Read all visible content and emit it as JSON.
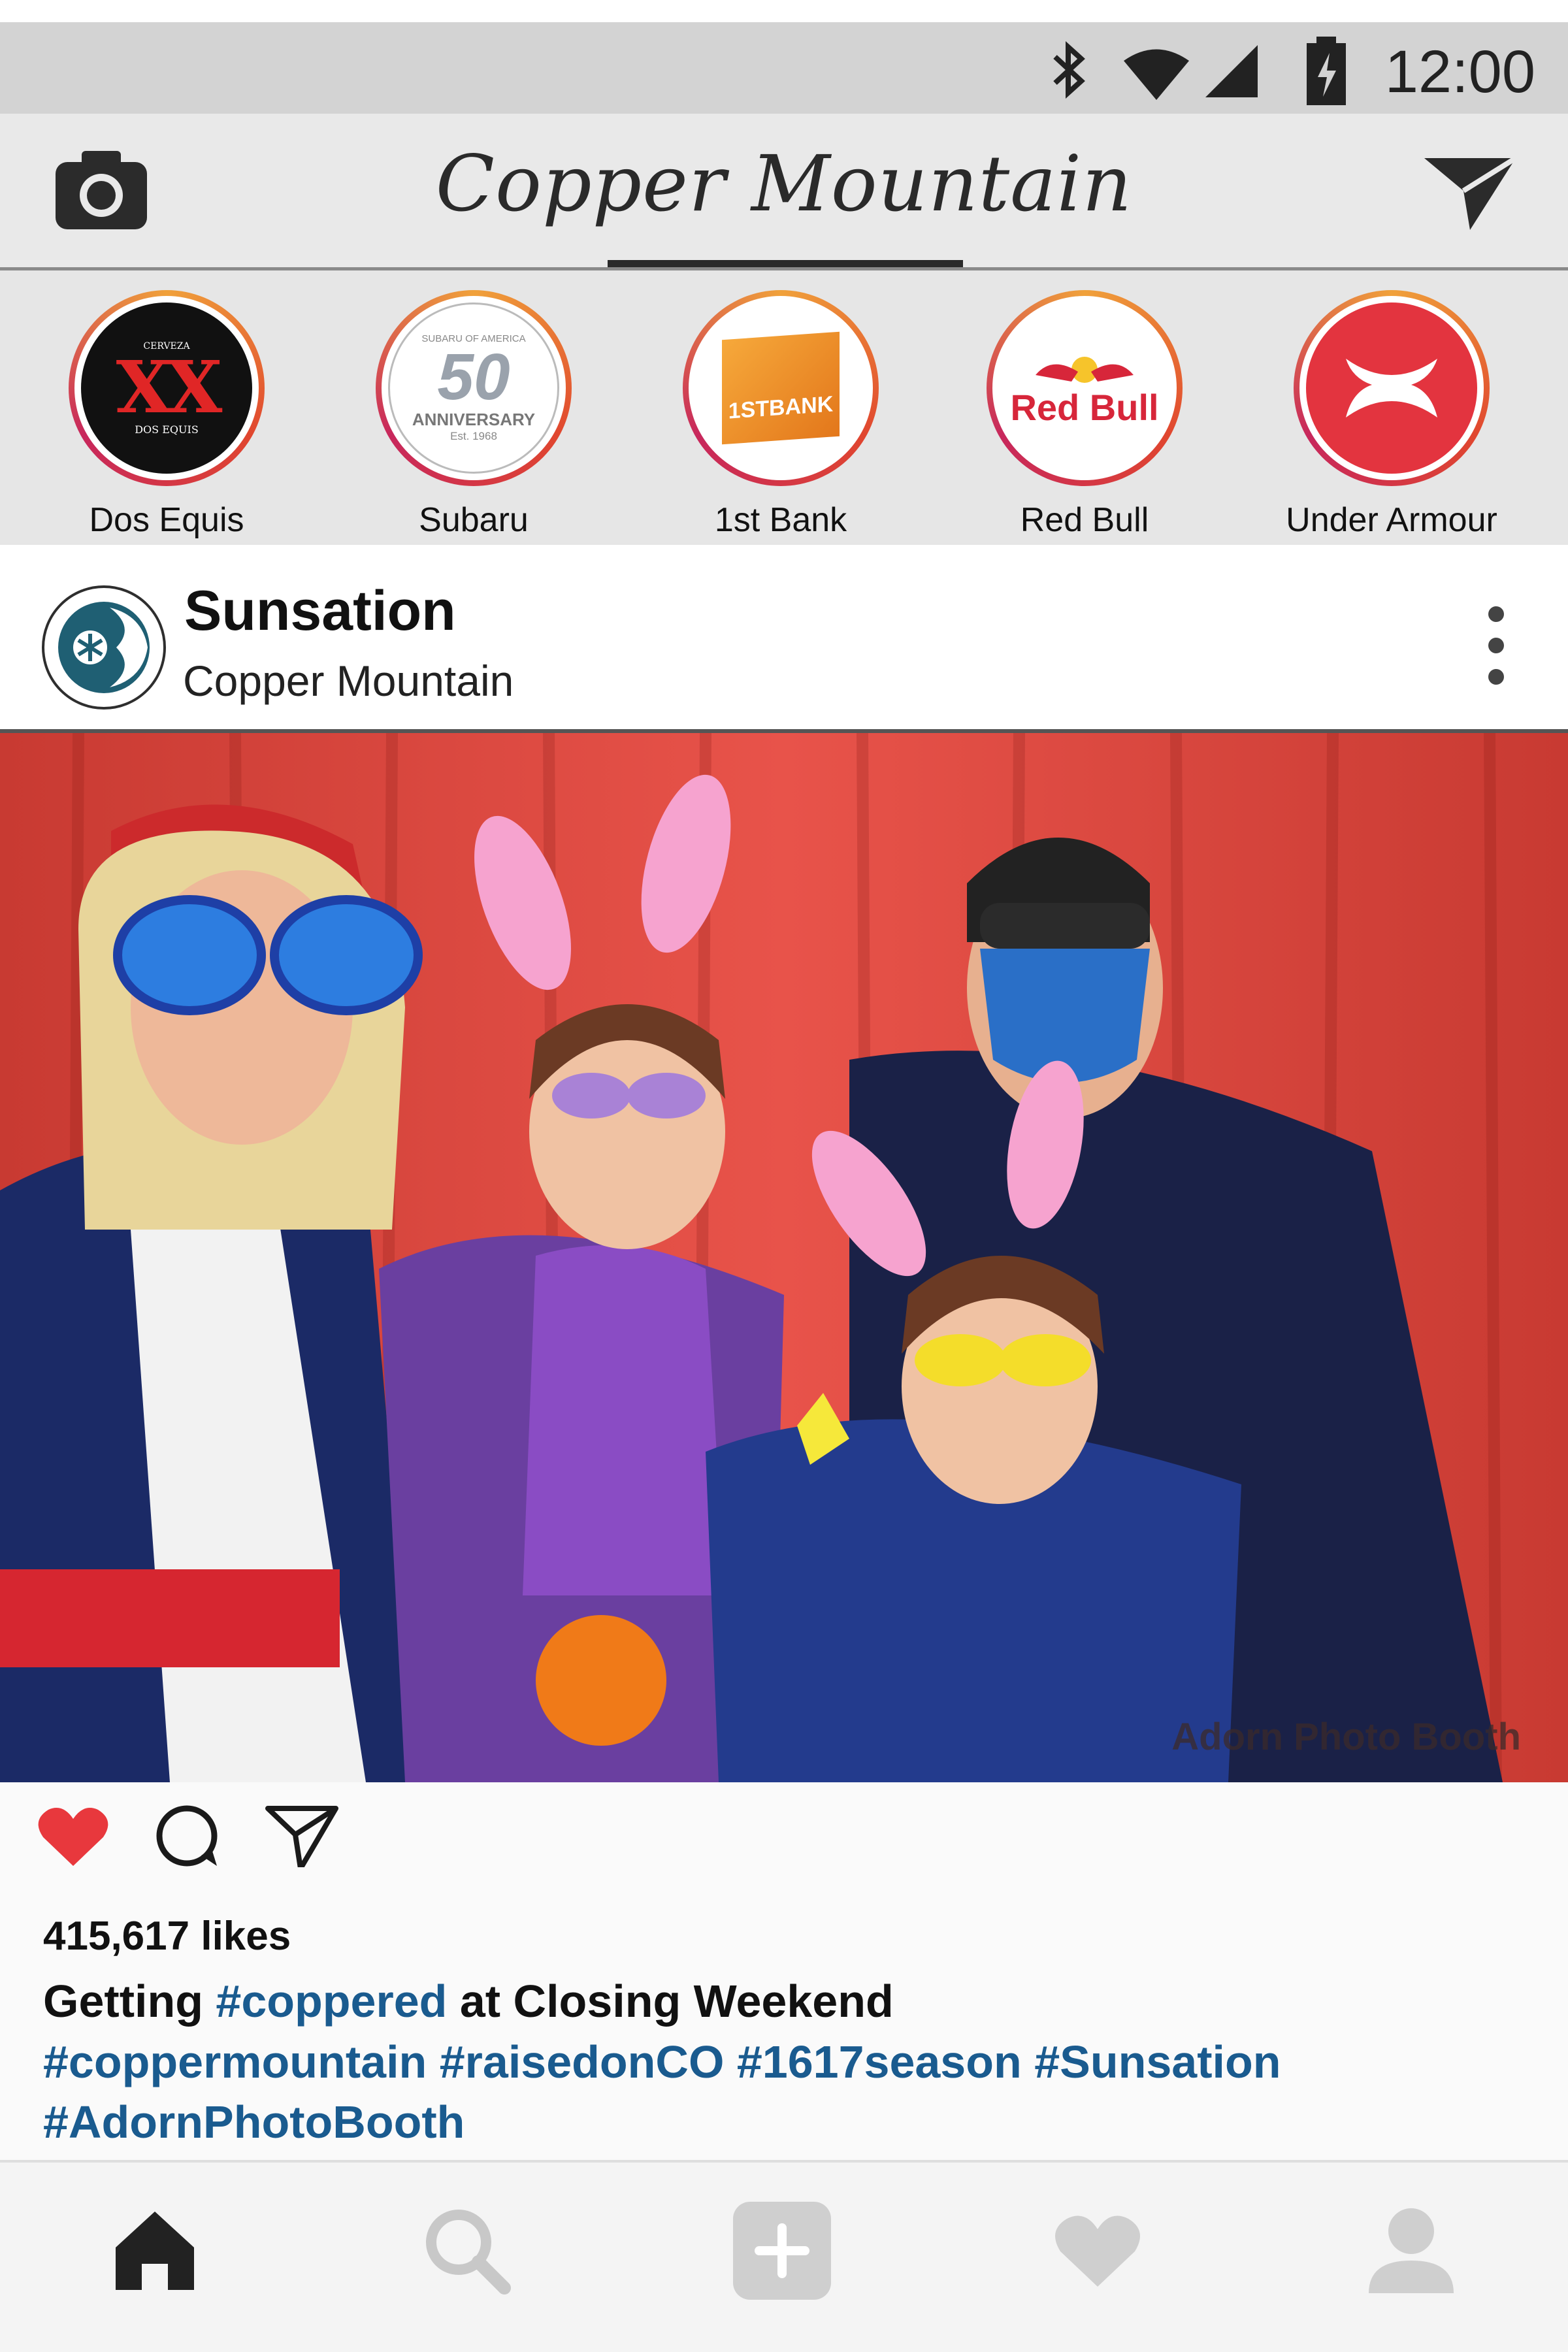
{
  "status_bar": {
    "time": "12:00",
    "icons": [
      "bluetooth-icon",
      "wifi-icon",
      "signal-icon",
      "battery-charging-icon"
    ]
  },
  "header": {
    "title": "Copper Mountain",
    "left_icon": "camera-icon",
    "right_icon": "send-icon"
  },
  "stories": [
    {
      "label": "Dos Equis",
      "logo_text": "XX",
      "logo_sub": "DOS EQUIS",
      "logo_top": "CERVEZA"
    },
    {
      "label": "Subaru",
      "logo_text": "50",
      "logo_sub": "ANNIVERSARY",
      "logo_top": "SUBARU OF AMERICA",
      "logo_est": "Est. 1968"
    },
    {
      "label": "1st Bank",
      "logo_text": "1STBANK"
    },
    {
      "label": "Red Bull",
      "logo_text": "Red Bull"
    },
    {
      "label": "Under Armour",
      "logo_text": "UA"
    }
  ],
  "post": {
    "account_name": "Sunsation",
    "location": "Copper Mountain",
    "photo_watermark": "Adorn Photo Booth",
    "likes": "415,617 likes",
    "caption": {
      "pre": "Getting ",
      "tag1": "#coppered",
      "post": " at Closing Weekend",
      "line2": "#coppermountain #raisedonCO #1617season #Sunsation",
      "line3": "#AdornPhotoBooth"
    },
    "actions": [
      "heart-filled-icon",
      "comment-icon",
      "share-icon"
    ]
  },
  "bottom_nav": [
    "home-icon",
    "search-icon",
    "add-post-icon",
    "activity-heart-icon",
    "profile-icon"
  ],
  "colors": {
    "heart": "#e8383d",
    "hashtag": "#1a5b8f",
    "story_ring": "#e0462f"
  }
}
